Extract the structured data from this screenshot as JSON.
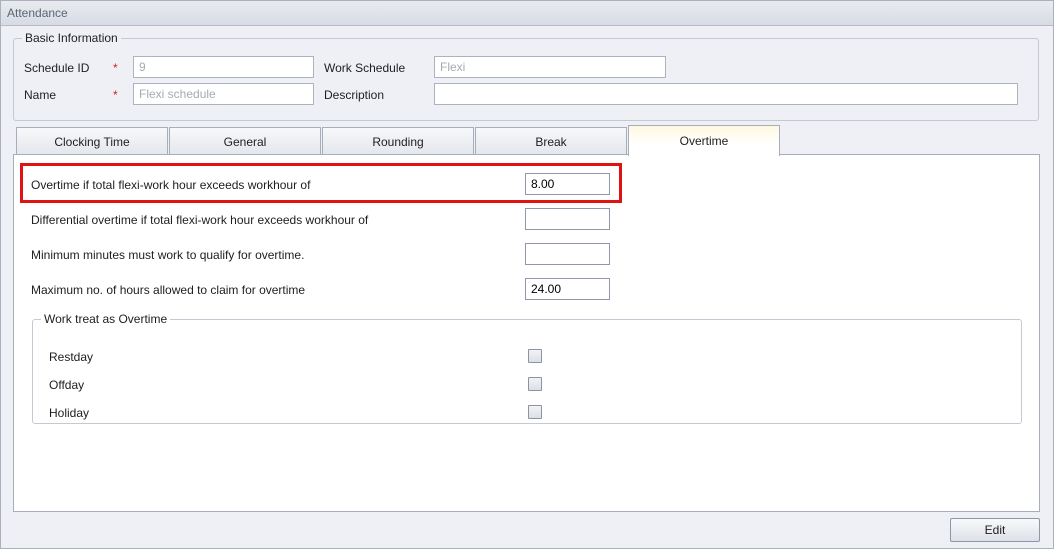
{
  "window": {
    "title": "Attendance"
  },
  "basic_info": {
    "legend": "Basic Information",
    "schedule_id_label": "Schedule ID",
    "schedule_id_value": "9",
    "name_label": "Name",
    "name_value": "Flexi schedule",
    "required_mark": "*",
    "work_schedule_label": "Work Schedule",
    "work_schedule_value": "Flexi",
    "description_label": "Description",
    "description_value": ""
  },
  "tabs": [
    {
      "label": "Clocking Time",
      "active": false
    },
    {
      "label": "General",
      "active": false
    },
    {
      "label": "Rounding",
      "active": false
    },
    {
      "label": "Break",
      "active": false
    },
    {
      "label": "Overtime",
      "active": true
    }
  ],
  "overtime": {
    "rows": [
      {
        "label": "Overtime if total flexi-work hour exceeds workhour of",
        "value": "8.00"
      },
      {
        "label": "Differential overtime if total flexi-work hour exceeds workhour of",
        "value": ""
      },
      {
        "label": "Minimum minutes must work to qualify for overtime.",
        "value": ""
      },
      {
        "label": "Maximum no. of hours allowed to claim for overtime",
        "value": "24.00"
      }
    ],
    "work_treat": {
      "legend": "Work treat as Overtime",
      "items": [
        {
          "label": "Restday",
          "checked": false
        },
        {
          "label": "Offday",
          "checked": false
        },
        {
          "label": "Holiday",
          "checked": false
        }
      ]
    }
  },
  "footer": {
    "edit_label": "Edit"
  },
  "colors": {
    "highlight": "#e01212",
    "required": "#d42020",
    "active_tab": "#fff8df"
  }
}
